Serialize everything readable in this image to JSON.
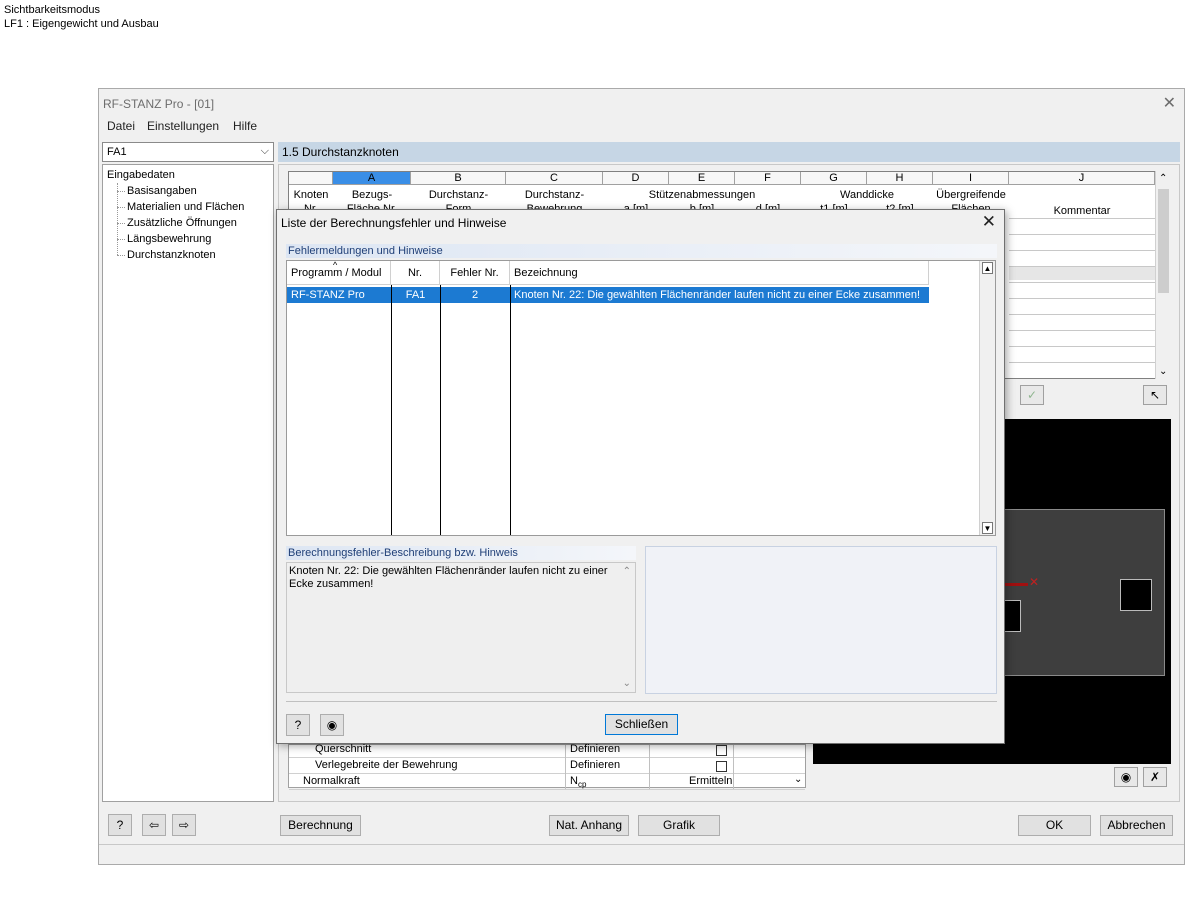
{
  "canvas": {
    "line1": "Sichtbarkeitsmodus",
    "line2": "LF1 : Eigengewicht und Ausbau"
  },
  "window": {
    "title": "RF-STANZ Pro - [01]",
    "menu": [
      "Datei",
      "Einstellungen",
      "Hilfe"
    ]
  },
  "left_pane": {
    "case_select": "FA1",
    "tree_root": "Eingabedaten",
    "tree_items": [
      "Basisangaben",
      "Materialien und Flächen",
      "Zusätzliche Öffnungen",
      "Längsbewehrung",
      "Durchstanzknoten"
    ]
  },
  "section": {
    "title": "1.5 Durchstanzknoten"
  },
  "grid": {
    "col_letters": [
      "A",
      "B",
      "C",
      "D",
      "E",
      "F",
      "G",
      "H",
      "I",
      "J"
    ],
    "heads": {
      "knoten": "Knoten",
      "knoten2": "Nr.",
      "a": "Bezugs-",
      "a2": "Fläche Nr.",
      "b": "Durchstanz-",
      "b2": "Form",
      "c": "Durchstanz-",
      "c2": "Bewehrung",
      "def": "Stützenabmessungen",
      "d": "a [m]",
      "e": "b [m]",
      "f": "d [m]",
      "gh": "Wanddicke",
      "g": "t1 [m]",
      "h": "t2 [m]",
      "i": "Übergreifende",
      "i2": "Flächen",
      "j": "Kommentar"
    }
  },
  "property_table": {
    "rows": [
      {
        "label": "Querschnitt",
        "value": "Definieren"
      },
      {
        "label": "Verlegebreite der Bewehrung",
        "value": "Definieren"
      },
      {
        "label": "Normalkraft",
        "value": "N",
        "value_sub": "cp",
        "action": "Ermitteln"
      }
    ]
  },
  "bottom_buttons": {
    "calc": "Berechnung",
    "nat": "Nat. Anhang",
    "grafik": "Grafik",
    "ok": "OK",
    "cancel": "Abbrechen"
  },
  "dialog": {
    "title": "Liste der Berechnungsfehler und Hinweise",
    "group_errors": "Fehlermeldungen und Hinweise",
    "columns": [
      "Programm / Modul",
      "Nr.",
      "Fehler Nr.",
      "Bezeichnung"
    ],
    "rows": [
      {
        "program": "RF-STANZ Pro",
        "nr": "FA1",
        "error_nr": "2",
        "text": "Knoten Nr. 22: Die gewählten Flächenränder laufen nicht zu einer Ecke zusammen!"
      }
    ],
    "group_desc": "Berechnungsfehler-Beschreibung bzw. Hinweis",
    "description": "Knoten Nr. 22: Die gewählten Flächenränder laufen nicht zu einer Ecke zusammen!",
    "close_label": "Schließen"
  },
  "icons": [
    "help-icon",
    "eye-icon",
    "checkmark-icon",
    "pointer-icon",
    "export-icon",
    "import-icon",
    "close-icon",
    "chevron-down-icon",
    "sort-up-icon"
  ],
  "colors": {
    "selection": "#1c7ad2",
    "section_header": "#c6d6e5",
    "group_text": "#1f3f77",
    "axis": "#a01010"
  }
}
